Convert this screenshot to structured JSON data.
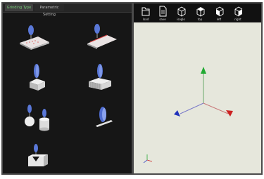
{
  "tabs": [
    {
      "label": "Grinding Type",
      "active": true
    },
    {
      "label": "Parametric Setting",
      "active": false
    }
  ],
  "grinding_types": [
    {
      "icon": "tilted-plate-with-dots-icon"
    },
    {
      "icon": "tilted-plate-with-red-edge-icon"
    },
    {
      "icon": "wheel-on-block-icon"
    },
    {
      "icon": "wheel-on-ridged-block-icon"
    },
    {
      "icon": "two-wheels-on-ball-and-cylinder-icon"
    },
    {
      "icon": "cup-wheel-on-rod-icon"
    },
    {
      "icon": "wheel-on-v-block-icon"
    }
  ],
  "toolbar": [
    {
      "label": "load",
      "icon": "folder-icon"
    },
    {
      "label": "save",
      "icon": "document-icon"
    },
    {
      "label": "isoglo",
      "icon": "cube-iso-icon"
    },
    {
      "label": "top",
      "icon": "cube-top-icon"
    },
    {
      "label": "left",
      "icon": "cube-left-icon"
    },
    {
      "label": "right",
      "icon": "cube-right-icon"
    }
  ],
  "viewport": {
    "background": "#e6e7dc",
    "axis_colors": {
      "x": "#cc2222",
      "y": "#22aa33",
      "z": "#2233bb"
    }
  }
}
